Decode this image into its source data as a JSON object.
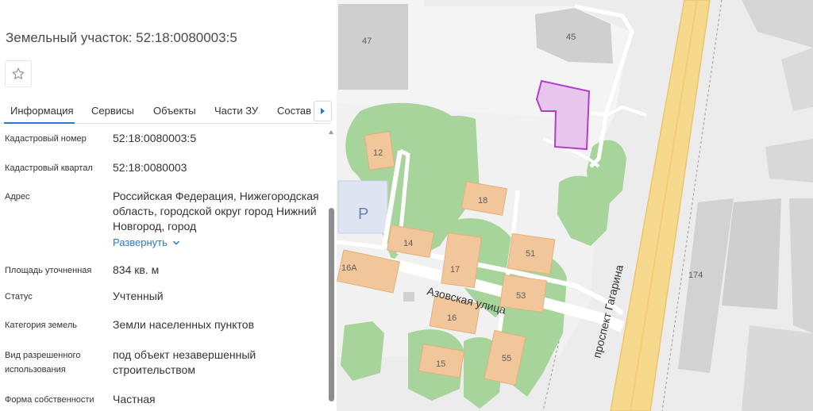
{
  "panel": {
    "title": "Земельный участок: 52:18:0080003:5",
    "favorite_icon": "star-outline-icon",
    "tabs": [
      {
        "label": "Информация",
        "active": true
      },
      {
        "label": "Сервисы",
        "active": false
      },
      {
        "label": "Объекты",
        "active": false
      },
      {
        "label": "Части ЗУ",
        "active": false
      },
      {
        "label": "Состав",
        "active": false
      }
    ],
    "tabs_next_icon": "arrow-right-icon",
    "rows": [
      {
        "label": "Кадастровый номер",
        "value": "52:18:0080003:5"
      },
      {
        "label": "Кадастровый квартал",
        "value": "52:18:0080003"
      },
      {
        "label": "Адрес",
        "value": "Российская Федерация, Нижегородская область, городской округ город Нижний Новгород, город",
        "link": "Развернуть"
      },
      {
        "label": "Площадь уточненная",
        "value": "834 кв. м"
      },
      {
        "label": "Статус",
        "value": "Учтенный"
      },
      {
        "label": "Категория земель",
        "value": "Земли населенных пунктов"
      },
      {
        "label": "Вид разрешенного использования",
        "value": "под объект незавершенный строительством"
      },
      {
        "label": "Форма собственности",
        "value": "Частная"
      }
    ],
    "expand_icon": "chevron-down-icon",
    "colors": {
      "accent": "#2b78c6",
      "parcel": "#b13dc8",
      "parcel_fill": "#e6c6ea",
      "road": "#f6d98d",
      "green": "#a7d49a",
      "building": "#f1c69a"
    }
  },
  "map": {
    "house_numbers": [
      "47",
      "45",
      "12",
      "18",
      "14",
      "17",
      "51",
      "16А",
      "53",
      "16",
      "55",
      "15",
      "174"
    ],
    "street_azovskaya": "Азовская улица",
    "street_gagarina": "проспект Гагарина",
    "parking_label": "P"
  }
}
